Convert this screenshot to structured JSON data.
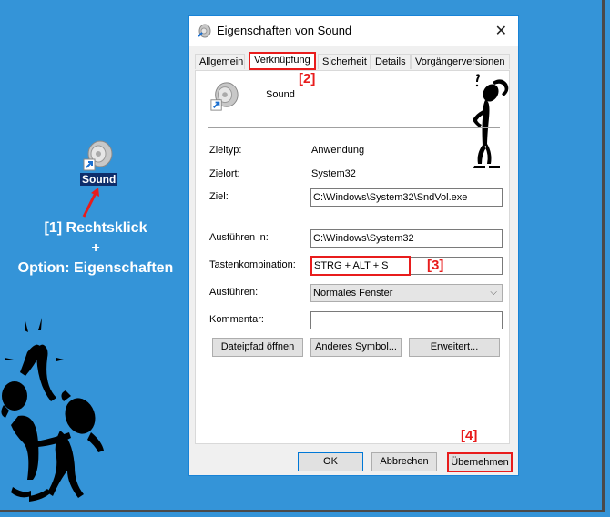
{
  "desktop": {
    "icon_label": "Sound",
    "annotation_1_line1": "[1] Rechtsklick",
    "annotation_1_line2": "+",
    "annotation_1_line3": "Option: Eigenschaften"
  },
  "dialog": {
    "title": "Eigenschaften von Sound",
    "close_glyph": "✕",
    "tabs": [
      {
        "label": "Allgemein"
      },
      {
        "label": "Verknüpfung",
        "active": true
      },
      {
        "label": "Sicherheit"
      },
      {
        "label": "Details"
      },
      {
        "label": "Vorgängerversionen"
      }
    ],
    "annotation_2": "[2]",
    "shortcut_name": "Sound",
    "fields": {
      "zieltyp_label": "Zieltyp:",
      "zieltyp_value": "Anwendung",
      "zielort_label": "Zielort:",
      "zielort_value": "System32",
      "ziel_label": "Ziel:",
      "ziel_value": "C:\\Windows\\System32\\SndVol.exe",
      "ausfuehren_in_label": "Ausführen in:",
      "ausfuehren_in_value": "C:\\Windows\\System32",
      "tastenkombination_label": "Tastenkombination:",
      "tastenkombination_value": "STRG + ALT + S",
      "ausfuehren_label": "Ausführen:",
      "ausfuehren_value": "Normales Fenster",
      "kommentar_label": "Kommentar:",
      "kommentar_value": ""
    },
    "annotation_3": "[3]",
    "buttons": {
      "dateipfad": "Dateipfad öffnen",
      "anderes_symbol": "Anderes Symbol...",
      "erweitert": "Erweitert..."
    },
    "annotation_4": "[4]",
    "footer": {
      "ok": "OK",
      "abbrechen": "Abbrechen",
      "uebernehmen": "Übernehmen"
    }
  },
  "colors": {
    "desktop_bg": "#3494d8",
    "annotation_red": "#e81c1c",
    "accent_blue": "#1883d7"
  }
}
